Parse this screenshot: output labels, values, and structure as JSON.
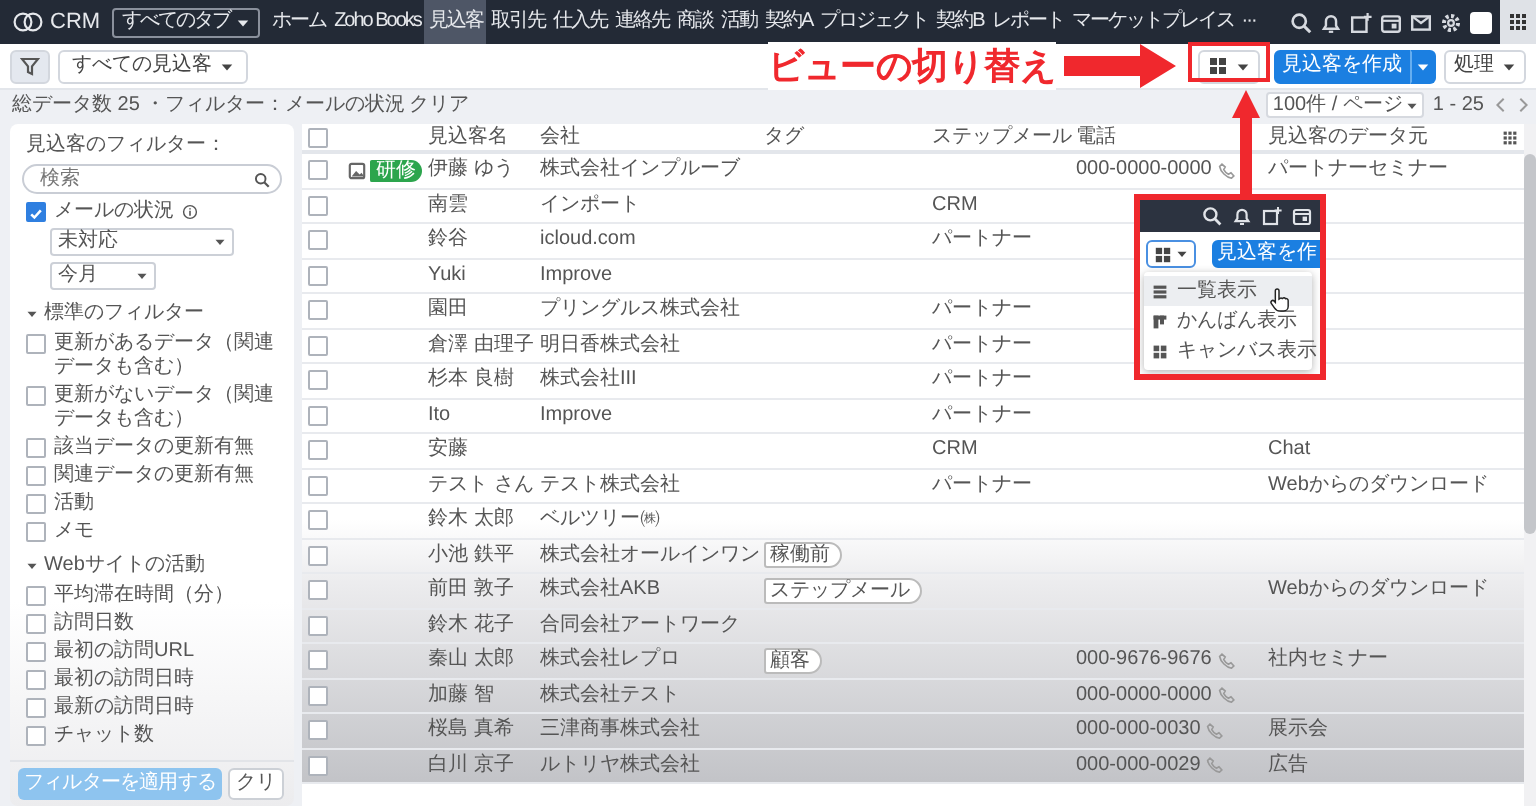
{
  "nav": {
    "app": "CRM",
    "all_tabs": "すべてのタブ",
    "more": "···",
    "tabs": [
      {
        "label": "ホーム",
        "selected": false
      },
      {
        "label": "Zoho Books",
        "selected": false
      },
      {
        "label": "見込客",
        "selected": true
      },
      {
        "label": "取引先",
        "selected": false
      },
      {
        "label": "仕入先",
        "selected": false
      },
      {
        "label": "連絡先",
        "selected": false
      },
      {
        "label": "商談",
        "selected": false
      },
      {
        "label": "活動",
        "selected": false
      },
      {
        "label": "契約A",
        "selected": false
      },
      {
        "label": "プロジェクト",
        "selected": false
      },
      {
        "label": "契約B",
        "selected": false
      },
      {
        "label": "レポート",
        "selected": false
      },
      {
        "label": "マーケットプレイス",
        "selected": false
      }
    ]
  },
  "toolbar": {
    "view": "すべての見込客",
    "create": "見込客を作成",
    "actions": "処理"
  },
  "summary": {
    "text": "総データ数 25 ・フィルター：メールの状況",
    "clear": "クリア",
    "per_page": "100件 / ページ",
    "range": "1 - 25"
  },
  "sidebar": {
    "title": "見込客のフィルター：",
    "search_placeholder": "検索",
    "email_filter": {
      "label": "メールの状況",
      "checked": true,
      "status": "未対応",
      "period": "今月"
    },
    "sections": [
      {
        "title": "標準のフィルター",
        "expanded": true,
        "items": [
          {
            "label": "更新があるデータ（関連データも含む）",
            "checked": false
          },
          {
            "label": "更新がないデータ（関連データも含む）",
            "checked": false
          },
          {
            "label": "該当データの更新有無",
            "checked": false
          },
          {
            "label": "関連データの更新有無",
            "checked": false
          },
          {
            "label": "活動",
            "checked": false
          },
          {
            "label": "メモ",
            "checked": false
          }
        ]
      },
      {
        "title": "Webサイトの活動",
        "expanded": true,
        "items": [
          {
            "label": "平均滞在時間（分）",
            "checked": false
          },
          {
            "label": "訪問日数",
            "checked": false
          },
          {
            "label": "最初の訪問URL",
            "checked": false
          },
          {
            "label": "最初の訪問日時",
            "checked": false
          },
          {
            "label": "最新の訪問日時",
            "checked": false
          },
          {
            "label": "チャット数",
            "checked": false
          }
        ]
      }
    ],
    "apply": {
      "label": "フィルターを適用する",
      "disabled": true
    },
    "clear": "クリ"
  },
  "table": {
    "select_all": false,
    "columns": [
      "見込客名",
      "会社",
      "タグ",
      "ステップメール",
      "電話",
      "見込客のデータ元"
    ],
    "rows": [
      {
        "checked": false,
        "badge": "研修",
        "name": "伊藤 ゆう",
        "company": "株式会社インプルーブ",
        "phone": "000-0000-0000",
        "source": "パートナーセミナー"
      },
      {
        "checked": false,
        "name": "南雲",
        "company": "インポート",
        "step": "CRM"
      },
      {
        "checked": false,
        "name": "鈴谷",
        "company": "icloud.com",
        "step": "パートナー"
      },
      {
        "checked": false,
        "name": "Yuki",
        "company": "Improve"
      },
      {
        "checked": false,
        "name": "園田",
        "company": "プリングルス株式会社",
        "step": "パートナー"
      },
      {
        "checked": false,
        "name": "倉澤 由理子",
        "company": "明日香株式会社",
        "step": "パートナー"
      },
      {
        "checked": false,
        "name": "杉本 良樹",
        "company": "株式会社III",
        "step": "パートナー"
      },
      {
        "checked": false,
        "name": "Ito",
        "company": "Improve",
        "step": "パートナー"
      },
      {
        "checked": false,
        "name": "安藤",
        "step": "CRM",
        "source": "Chat"
      },
      {
        "checked": false,
        "name": "テスト さん",
        "company": "テスト株式会社",
        "step": "パートナー",
        "source": "Webからのダウンロード"
      },
      {
        "checked": false,
        "name": "鈴木 太郎",
        "company": "ベルツリー㈱"
      },
      {
        "checked": false,
        "name": "小池 鉄平",
        "company": "株式会社オールインワン",
        "tag": "稼働前"
      },
      {
        "checked": false,
        "name": "前田 敦子",
        "company": "株式会社AKB",
        "tag": "ステップメール",
        "source": "Webからのダウンロード"
      },
      {
        "checked": false,
        "name": "鈴木 花子",
        "company": "合同会社アートワーク"
      },
      {
        "checked": false,
        "name": "秦山 太郎",
        "company": "株式会社レプロ",
        "tag": "顧客",
        "phone": "000-9676-9676",
        "source": "社内セミナー"
      },
      {
        "checked": false,
        "name": "加藤 智",
        "company": "株式会社テスト",
        "phone": "000-0000-0000"
      },
      {
        "checked": false,
        "name": "桜島 真希",
        "company": "三津商事株式会社",
        "phone": "000-000-0030",
        "source": "展示会"
      },
      {
        "checked": false,
        "name": "白川 京子",
        "company": "ルトリヤ株式会社",
        "phone": "000-000-0029",
        "source": "広告"
      }
    ]
  },
  "annotation": {
    "label": "ビューの切り替え",
    "callout": {
      "create": "見込客を作",
      "menu": [
        {
          "kind": "list",
          "label": "一覧表示",
          "selected": true
        },
        {
          "kind": "kanban",
          "label": "かんばん表示",
          "selected": false
        },
        {
          "kind": "canvas",
          "label": "キャンバス表示",
          "selected": false
        }
      ]
    }
  }
}
